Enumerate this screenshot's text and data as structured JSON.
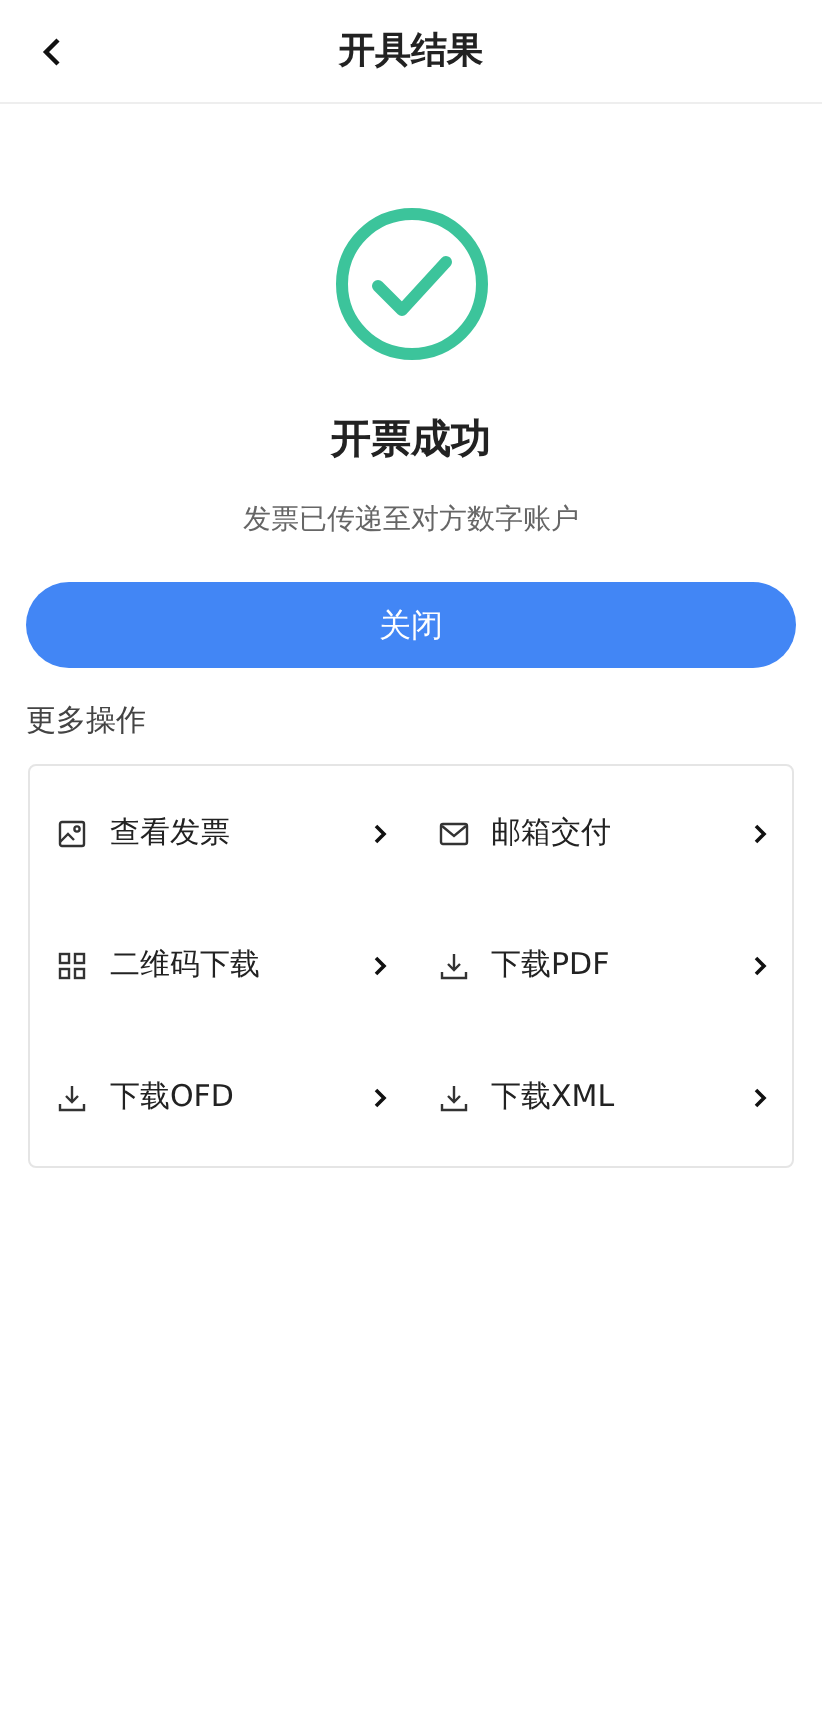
{
  "header": {
    "title": "开具结果"
  },
  "result": {
    "title": "开票成功",
    "message": "发票已传递至对方数字账户"
  },
  "close_button": {
    "label": "关闭"
  },
  "more": {
    "title": "更多操作",
    "actions": [
      {
        "kind": "image",
        "label": "查看发票"
      },
      {
        "kind": "mail",
        "label": "邮箱交付"
      },
      {
        "kind": "qrcode",
        "label": "二维码下载"
      },
      {
        "kind": "download",
        "label": "下载PDF"
      },
      {
        "kind": "download",
        "label": "下载OFD"
      },
      {
        "kind": "download",
        "label": "下载XML"
      }
    ]
  }
}
